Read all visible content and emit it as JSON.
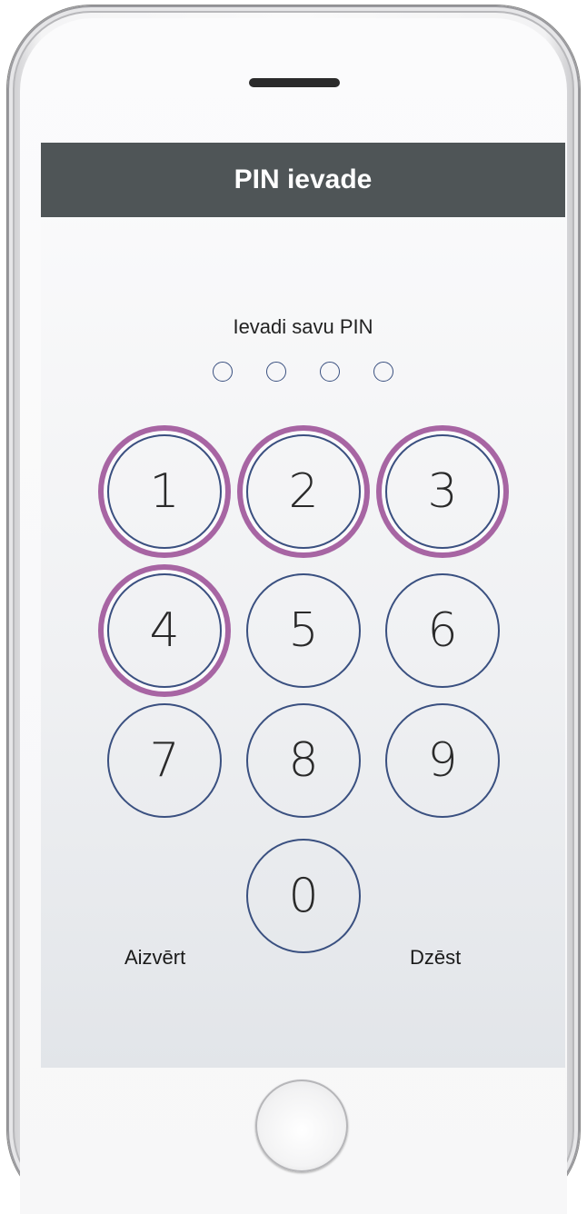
{
  "header": {
    "title": "PIN ievade"
  },
  "prompt": "Ievadi savu PIN",
  "pin_length": 4,
  "keypad": {
    "keys": [
      "1",
      "2",
      "3",
      "4",
      "5",
      "6",
      "7",
      "8",
      "9",
      "0"
    ],
    "highlighted": [
      "1",
      "2",
      "3",
      "4"
    ]
  },
  "actions": {
    "close_label": "Aizvērt",
    "delete_label": "Dzēst"
  },
  "colors": {
    "title_bar": "#4f5557",
    "key_border": "#3a5080",
    "highlight_ring": "#a765a3"
  }
}
